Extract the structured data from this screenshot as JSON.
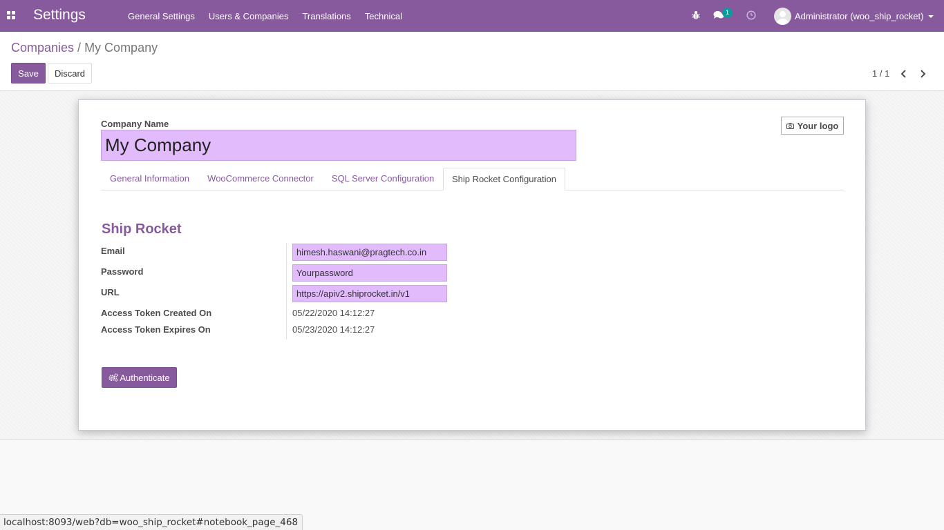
{
  "navbar": {
    "app_title": "Settings",
    "menu": [
      "General Settings",
      "Users & Companies",
      "Translations",
      "Technical"
    ],
    "chat_count": "1",
    "user_name": "Administrator (woo_ship_rocket)",
    "icons": [
      "apps-icon",
      "bug-icon",
      "chat-icon",
      "clock-icon",
      "chevron-down-icon"
    ],
    "accent_color": "#875a9e"
  },
  "breadcrumb": {
    "parent": "Companies",
    "separator": "/",
    "current": "My Company"
  },
  "actions": {
    "save_label": "Save",
    "discard_label": "Discard"
  },
  "pager": {
    "value": "1 / 1"
  },
  "form": {
    "company_name_label": "Company Name",
    "company_name": "My Company",
    "logo_label": "Your logo",
    "tabs": [
      {
        "label": "General Information",
        "active": false
      },
      {
        "label": "WooCommerce Connector",
        "active": false
      },
      {
        "label": "SQL Server Configuration",
        "active": false
      },
      {
        "label": "Ship Rocket Configuration",
        "active": true
      }
    ],
    "section_title": "Ship Rocket",
    "fields": {
      "email": {
        "label": "Email",
        "value": "himesh.haswani@pragtech.co.in"
      },
      "password": {
        "label": "Password",
        "value": "Yourpassword"
      },
      "url": {
        "label": "URL",
        "value": "https://apiv2.shiprocket.in/v1"
      },
      "token_created": {
        "label": "Access Token Created On",
        "value": "05/22/2020 14:12:27"
      },
      "token_expires": {
        "label": "Access Token Expires On",
        "value": "05/23/2020 14:12:27"
      }
    },
    "authenticate_label": "Authenticate",
    "required_field_color": "#e1bbfb"
  },
  "statusbar": {
    "url": "localhost:8093/web?db=woo_ship_rocket#notebook_page_468"
  }
}
